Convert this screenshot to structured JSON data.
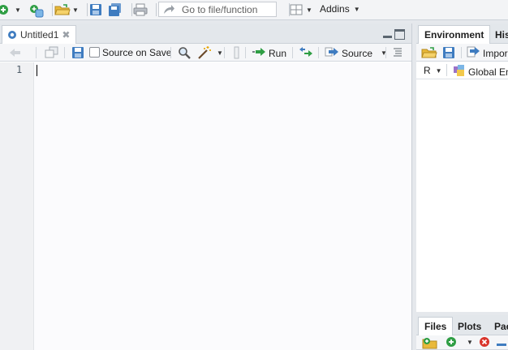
{
  "toolbar": {
    "goto_placeholder": "Go to file/function",
    "addins_label": "Addins"
  },
  "editor": {
    "tab_title": "Untitled1",
    "source_on_save_label": "Source on Save",
    "run_label": "Run",
    "source_label": "Source",
    "line_numbers": [
      "1"
    ]
  },
  "environment_pane": {
    "tabs": [
      "Environment",
      "His"
    ],
    "import_label": "Impor",
    "r_label": "R",
    "global_env_label": "Global Env"
  },
  "files_pane": {
    "tabs": [
      "Files",
      "Plots",
      "Pac"
    ]
  },
  "colors": {
    "accent_green": "#2f9e44",
    "accent_blue": "#3f7cc0",
    "folder_yellow": "#e9b93a",
    "delete_red": "#d9342b"
  }
}
